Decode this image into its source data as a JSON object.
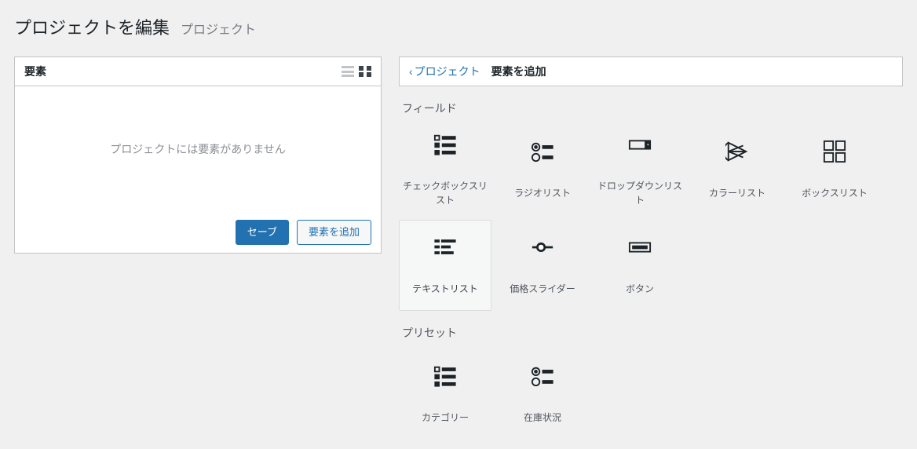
{
  "header": {
    "title": "プロジェクトを編集",
    "subtitle": "プロジェクト"
  },
  "left_panel": {
    "title": "要素",
    "empty_message": "プロジェクトには要素がありません",
    "save_label": "セーブ",
    "add_element_label": "要素を追加"
  },
  "right_panel": {
    "breadcrumb_back": "プロジェクト",
    "breadcrumb_current": "要素を追加",
    "section_fields": "フィールド",
    "section_presets": "プリセット",
    "fields": [
      {
        "id": "checkbox-list",
        "label": "チェックボックスリスト"
      },
      {
        "id": "radio-list",
        "label": "ラジオリスト"
      },
      {
        "id": "dropdown-list",
        "label": "ドロップダウンリスト"
      },
      {
        "id": "color-list",
        "label": "カラーリスト"
      },
      {
        "id": "box-list",
        "label": "ボックスリスト"
      },
      {
        "id": "text-list",
        "label": "テキストリスト"
      },
      {
        "id": "price-slider",
        "label": "価格スライダー"
      },
      {
        "id": "button",
        "label": "ボタン"
      }
    ],
    "presets": [
      {
        "id": "category",
        "label": "カテゴリー"
      },
      {
        "id": "stock-status",
        "label": "在庫状況"
      }
    ]
  }
}
